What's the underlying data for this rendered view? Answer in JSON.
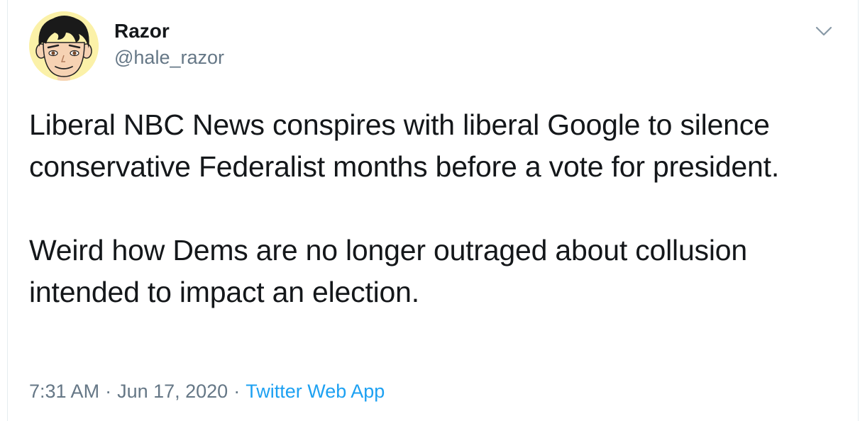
{
  "tweet": {
    "author": {
      "display_name": "Razor",
      "handle": "@hale_razor",
      "avatar_icon": "cartoon-avatar-icon"
    },
    "paragraphs": [
      "Liberal NBC News conspires with liberal Google to silence conservative Federalist months before a vote for president.",
      "Weird how Dems are no longer outraged about collusion intended to impact an election."
    ],
    "time": "7:31 AM",
    "date": "Jun 17, 2020",
    "separator": "·",
    "source": "Twitter Web App",
    "menu_icon": "chevron-down-icon"
  },
  "colors": {
    "text_primary": "#14171a",
    "text_secondary": "#657786",
    "link": "#1da1f2",
    "border": "#e6ecf0",
    "avatar_bg": "#fbf1a8"
  }
}
